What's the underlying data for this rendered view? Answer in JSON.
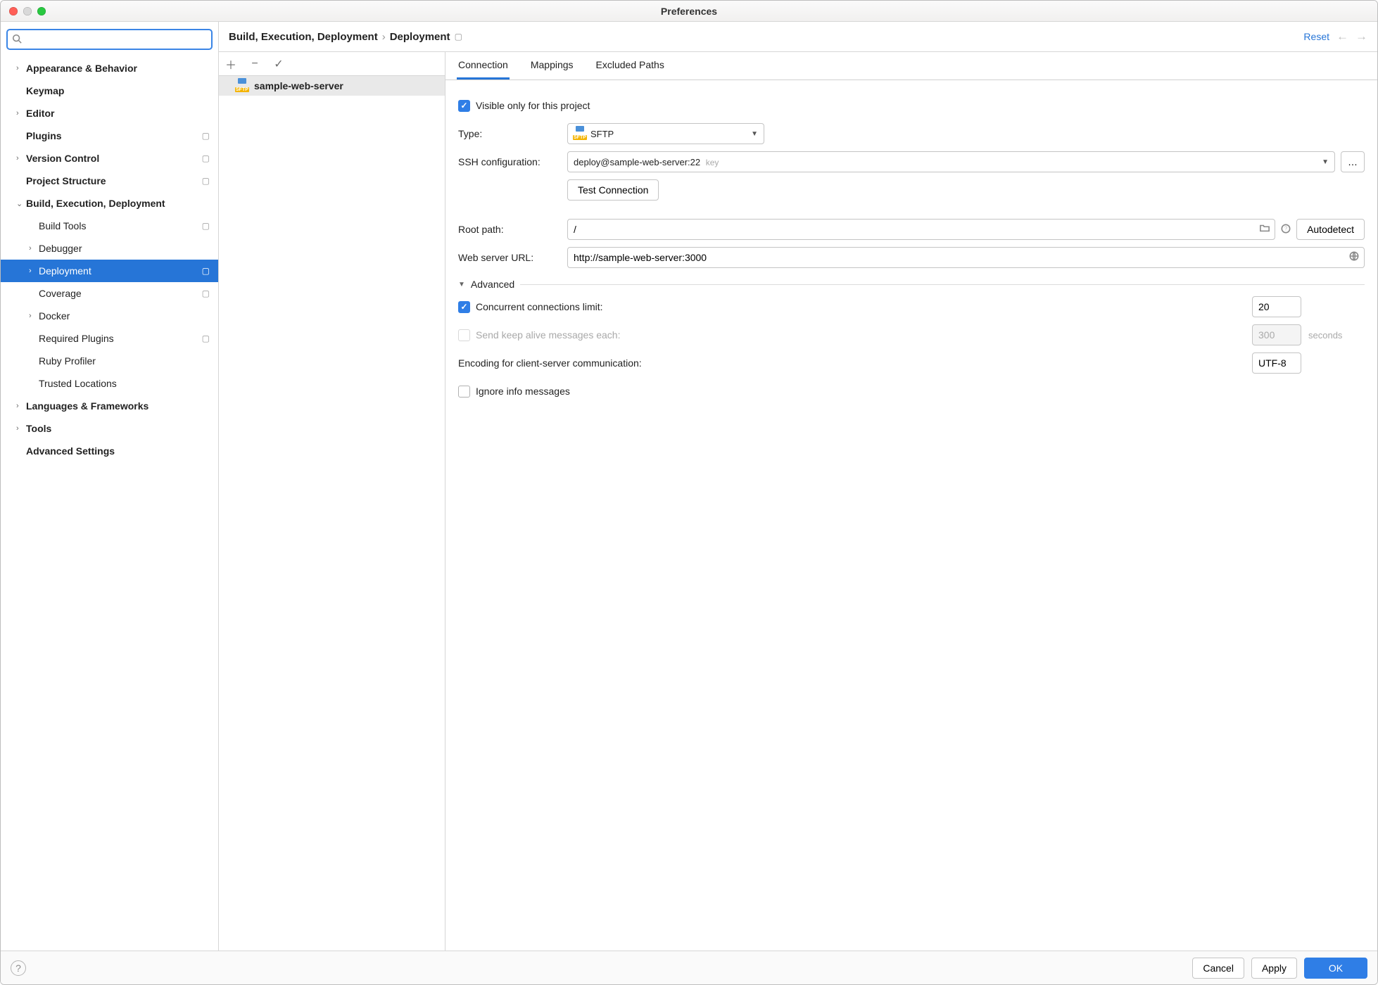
{
  "window": {
    "title": "Preferences"
  },
  "sidebar": {
    "search": {
      "placeholder": ""
    },
    "nodes": [
      {
        "label": "Appearance & Behavior",
        "bold": true,
        "arrow": "right",
        "depth": 0
      },
      {
        "label": "Keymap",
        "bold": true,
        "arrow": "none",
        "depth": 0
      },
      {
        "label": "Editor",
        "bold": true,
        "arrow": "right",
        "depth": 0
      },
      {
        "label": "Plugins",
        "bold": true,
        "arrow": "none",
        "depth": 0,
        "proj": true
      },
      {
        "label": "Version Control",
        "bold": true,
        "arrow": "right",
        "depth": 0,
        "proj": true
      },
      {
        "label": "Project Structure",
        "bold": true,
        "arrow": "none",
        "depth": 0,
        "proj": true
      },
      {
        "label": "Build, Execution, Deployment",
        "bold": true,
        "arrow": "down",
        "depth": 0
      },
      {
        "label": "Build Tools",
        "bold": false,
        "arrow": "none",
        "depth": 1,
        "proj": true
      },
      {
        "label": "Debugger",
        "bold": false,
        "arrow": "right",
        "depth": 1
      },
      {
        "label": "Deployment",
        "bold": false,
        "arrow": "right",
        "depth": 1,
        "proj": true,
        "selected": true
      },
      {
        "label": "Coverage",
        "bold": false,
        "arrow": "none",
        "depth": 1,
        "proj": true
      },
      {
        "label": "Docker",
        "bold": false,
        "arrow": "right",
        "depth": 1
      },
      {
        "label": "Required Plugins",
        "bold": false,
        "arrow": "none",
        "depth": 1,
        "proj": true
      },
      {
        "label": "Ruby Profiler",
        "bold": false,
        "arrow": "none",
        "depth": 1
      },
      {
        "label": "Trusted Locations",
        "bold": false,
        "arrow": "none",
        "depth": 1
      },
      {
        "label": "Languages & Frameworks",
        "bold": true,
        "arrow": "right",
        "depth": 0
      },
      {
        "label": "Tools",
        "bold": true,
        "arrow": "right",
        "depth": 0
      },
      {
        "label": "Advanced Settings",
        "bold": true,
        "arrow": "none",
        "depth": 0
      }
    ]
  },
  "header": {
    "breadcrumb_parent": "Build, Execution, Deployment",
    "breadcrumb_leaf": "Deployment",
    "reset": "Reset"
  },
  "servers": {
    "list": [
      {
        "name": "sample-web-server"
      }
    ]
  },
  "tabs": [
    {
      "label": "Connection",
      "active": true
    },
    {
      "label": "Mappings",
      "active": false
    },
    {
      "label": "Excluded Paths",
      "active": false
    }
  ],
  "form": {
    "visible_only": "Visible only for this project",
    "type_label": "Type:",
    "type_value": "SFTP",
    "ssh_label": "SSH configuration:",
    "ssh_value": "deploy@sample-web-server:22",
    "ssh_key_suffix": "key",
    "test_connection": "Test Connection",
    "root_label": "Root path:",
    "root_value": "/",
    "autodetect": "Autodetect",
    "url_label": "Web server URL:",
    "url_value": "http://sample-web-server:3000",
    "advanced": "Advanced",
    "conc_label": "Concurrent connections limit:",
    "conc_value": "20",
    "keepalive_label": "Send keep alive messages each:",
    "keepalive_value": "300",
    "keepalive_unit": "seconds",
    "encoding_label": "Encoding for client-server communication:",
    "encoding_value": "UTF-8",
    "ignore_info": "Ignore info messages"
  },
  "footer": {
    "cancel": "Cancel",
    "apply": "Apply",
    "ok": "OK"
  }
}
